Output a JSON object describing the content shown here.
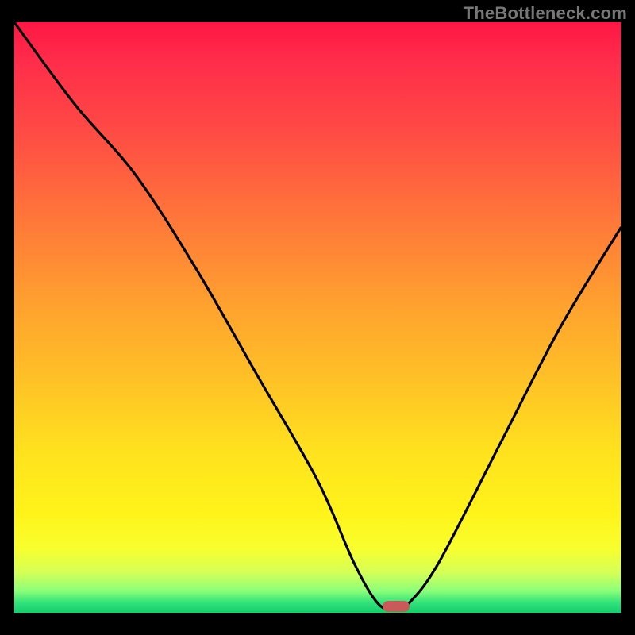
{
  "watermark": "TheBottleneck.com",
  "colors": {
    "background": "#000000",
    "curve": "#000000",
    "marker": "#c85a5a",
    "gradient_top": "#ff1744",
    "gradient_bottom": "#18cf6e"
  },
  "chart_data": {
    "type": "line",
    "title": "",
    "xlabel": "",
    "ylabel": "",
    "xlim": [
      0,
      100
    ],
    "ylim": [
      0,
      100
    ],
    "grid": false,
    "legend": false,
    "series": [
      {
        "name": "bottleneck-curve",
        "x": [
          0,
          10,
          20,
          30,
          40,
          50,
          56,
          60,
          63,
          65,
          70,
          80,
          90,
          100
        ],
        "y": [
          100,
          86,
          74,
          58,
          40,
          22,
          8,
          1,
          0,
          1,
          8,
          28,
          48,
          65
        ]
      }
    ],
    "marker": {
      "x": 63,
      "y": 0.5
    },
    "annotations": []
  }
}
